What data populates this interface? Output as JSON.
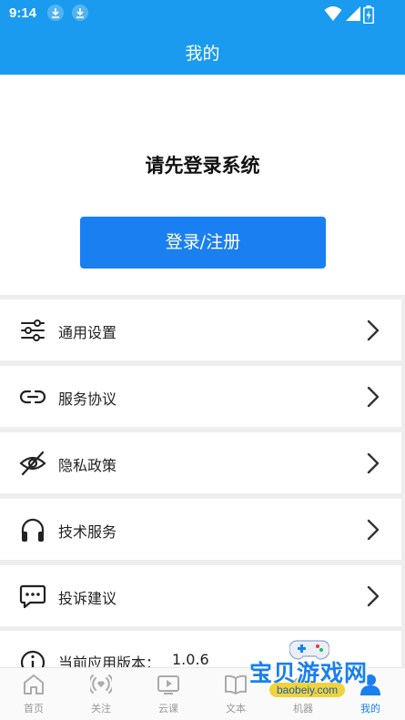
{
  "status_bar": {
    "time": "9:14"
  },
  "header": {
    "title": "我的"
  },
  "profile": {
    "prompt": "请先登录系统",
    "login_button": "登录/注册"
  },
  "menu": {
    "items": [
      {
        "label": "通用设置",
        "icon": "sliders-icon"
      },
      {
        "label": "服务协议",
        "icon": "link-icon"
      },
      {
        "label": "隐私政策",
        "icon": "eye-off-icon"
      },
      {
        "label": "技术服务",
        "icon": "headphones-icon"
      },
      {
        "label": "投诉建议",
        "icon": "chat-icon"
      }
    ],
    "version_label": "当前应用版本：",
    "version_value": "1.0.6"
  },
  "tabs": [
    {
      "label": "首页",
      "icon": "home-icon",
      "active": false
    },
    {
      "label": "关注",
      "icon": "broadcast-icon",
      "active": false
    },
    {
      "label": "云课",
      "icon": "video-icon",
      "active": false
    },
    {
      "label": "文本",
      "icon": "book-icon",
      "active": false
    },
    {
      "label": "机器",
      "icon": "robot-icon",
      "active": false
    },
    {
      "label": "我的",
      "icon": "user-icon",
      "active": true
    }
  ],
  "watermark": {
    "text": "宝贝游戏网",
    "url": "baobeiy.com"
  },
  "colors": {
    "primary": "#1a9bef",
    "button": "#1a7ff0",
    "background": "#eeeeee"
  }
}
